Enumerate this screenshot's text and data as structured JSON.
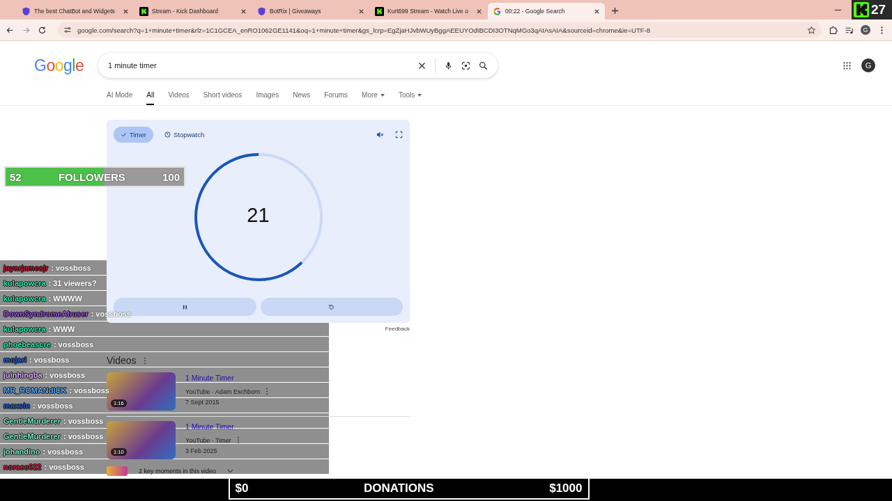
{
  "browser": {
    "tabs": [
      {
        "title": "The best ChatBot and Widgets",
        "kind": "shield",
        "selected": false
      },
      {
        "title": "Stream - Kick Dashboard",
        "kind": "k",
        "selected": false
      },
      {
        "title": "BotRix | Giveaways",
        "kind": "shield",
        "selected": false
      },
      {
        "title": "Kurt699 Stream - Watch Live o",
        "kind": "k",
        "selected": false
      },
      {
        "title": "00:22 - Google Search",
        "kind": "g",
        "selected": true
      }
    ],
    "url": "google.com/search?q=1+minute+timer&rlz=1C1GCEA_enRO1062GE1141&oq=1+minute+timer&gs_lcrp=EgZjaHJvbWUyBggAEEUYOdIBCDI3OTNqMGo3qAIAsAIA&sourceid=chrome&ie=UTF-8",
    "profile": "G"
  },
  "viewer_badge": {
    "count": "27"
  },
  "search": {
    "logo": "Google",
    "query": "1 minute timer",
    "avatar": "G",
    "nav": [
      {
        "label": "AI Mode",
        "selected": false,
        "dropdown": false
      },
      {
        "label": "All",
        "selected": true,
        "dropdown": false
      },
      {
        "label": "Videos",
        "selected": false,
        "dropdown": false
      },
      {
        "label": "Short videos",
        "selected": false,
        "dropdown": false
      },
      {
        "label": "Images",
        "selected": false,
        "dropdown": false
      },
      {
        "label": "News",
        "selected": false,
        "dropdown": false
      },
      {
        "label": "Forums",
        "selected": false,
        "dropdown": false
      },
      {
        "label": "More",
        "selected": false,
        "dropdown": true
      },
      {
        "label": "Tools",
        "selected": false,
        "dropdown": true
      }
    ]
  },
  "timer": {
    "modes": [
      {
        "label": "Timer",
        "selected": true
      },
      {
        "label": "Stopwatch",
        "selected": false
      }
    ],
    "seconds": "21",
    "level": 0.62,
    "feedback": "Feedback"
  },
  "videos": {
    "heading": "Videos",
    "results": [
      {
        "title": "1 Minute Timer",
        "source": "YouTube · Adam Eschborn",
        "date": "7 Sept 2015",
        "duration": "1:16"
      },
      {
        "title": "1 Minute Timer",
        "source": "YouTube · Timer",
        "date": "3 Feb 2025",
        "duration": "1:10"
      }
    ],
    "key_moments": "2 key moments in this video"
  },
  "followers_goal": {
    "current": "52",
    "label": "FOLLOWERS",
    "target": "100",
    "level": 0.55
  },
  "chat": [
    {
      "user": "jayarjamesjr",
      "color": "#c8102e",
      "text": ": vossboss"
    },
    {
      "user": "kulapowcra",
      "color": "#2ee8b0",
      "text": ": 31 viewers?"
    },
    {
      "user": "kulapowcra",
      "color": "#2ee8b0",
      "text": ": WWWW"
    },
    {
      "user": "DownSyndromeAbuser",
      "color": "#9b4de0",
      "text": ": vossboss"
    },
    {
      "user": "kulapowcra",
      "color": "#2ee8b0",
      "text": ": WWW"
    },
    {
      "user": "phoebeascre",
      "color": "#2ee8b0",
      "text": ": vossboss"
    },
    {
      "user": "mojari",
      "color": "#2060d0",
      "text": ": vossboss"
    },
    {
      "user": "juinhingba",
      "color": "#dcb4ff",
      "text": ": vossboss"
    },
    {
      "user": "MR_ROMANdICK",
      "color": "#60a8f0",
      "text": ": vossboss"
    },
    {
      "user": "maxsin",
      "color": "#2060d0",
      "text": ": vossboss"
    },
    {
      "user": "GentleMurderer",
      "color": "#7ee8c0",
      "text": ": vossboss"
    },
    {
      "user": "GentleMurderer",
      "color": "#7ee8c0",
      "text": ": vossboss"
    },
    {
      "user": "johandino",
      "color": "#7ee8c0",
      "text": ": vossboss"
    },
    {
      "user": "noraes622",
      "color": "#d0203c",
      "text": ": vossboss"
    }
  ],
  "donations_goal": {
    "current": "$0",
    "label": "DONATIONS",
    "target": "$1000",
    "level": 0.0
  }
}
